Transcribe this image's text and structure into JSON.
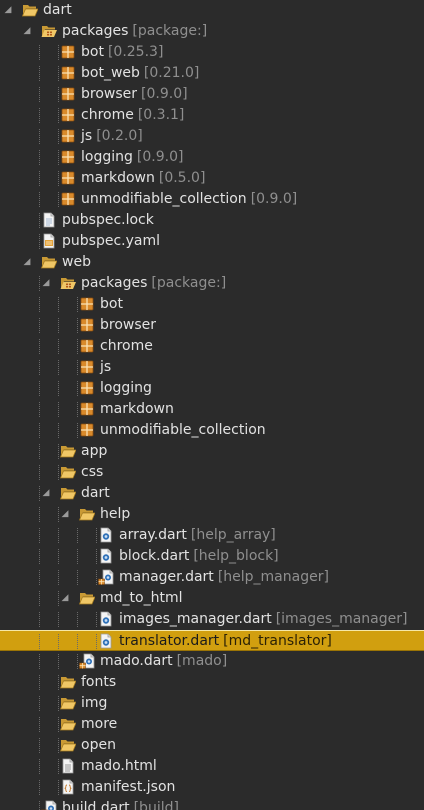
{
  "tree": [
    {
      "label": "dart",
      "decor": "",
      "icon": "folder-open-icon",
      "depth": 0,
      "expanded": true
    },
    {
      "label": "packages",
      "decor": "[package:]",
      "icon": "package-folder-open-icon",
      "depth": 1,
      "expanded": true
    },
    {
      "label": "bot",
      "decor": "[0.25.3]",
      "icon": "package-icon",
      "depth": 2
    },
    {
      "label": "bot_web",
      "decor": "[0.21.0]",
      "icon": "package-icon",
      "depth": 2
    },
    {
      "label": "browser",
      "decor": "[0.9.0]",
      "icon": "package-icon",
      "depth": 2
    },
    {
      "label": "chrome",
      "decor": "[0.3.1]",
      "icon": "package-icon",
      "depth": 2
    },
    {
      "label": "js",
      "decor": "[0.2.0]",
      "icon": "package-icon",
      "depth": 2
    },
    {
      "label": "logging",
      "decor": "[0.9.0]",
      "icon": "package-icon",
      "depth": 2
    },
    {
      "label": "markdown",
      "decor": "[0.5.0]",
      "icon": "package-icon",
      "depth": 2
    },
    {
      "label": "unmodifiable_collection",
      "decor": "[0.9.0]",
      "icon": "package-icon",
      "depth": 2
    },
    {
      "label": "pubspec.lock",
      "decor": "",
      "icon": "file-icon",
      "depth": 1
    },
    {
      "label": "pubspec.yaml",
      "decor": "",
      "icon": "yaml-file-icon",
      "depth": 1
    },
    {
      "label": "web",
      "decor": "",
      "icon": "folder-open-icon",
      "depth": 1,
      "expanded": true
    },
    {
      "label": "packages",
      "decor": "[package:]",
      "icon": "package-folder-open-icon",
      "depth": 2,
      "expanded": true
    },
    {
      "label": "bot",
      "decor": "",
      "icon": "package-icon",
      "depth": 3
    },
    {
      "label": "browser",
      "decor": "",
      "icon": "package-icon",
      "depth": 3
    },
    {
      "label": "chrome",
      "decor": "",
      "icon": "package-icon",
      "depth": 3
    },
    {
      "label": "js",
      "decor": "",
      "icon": "package-icon",
      "depth": 3
    },
    {
      "label": "logging",
      "decor": "",
      "icon": "package-icon",
      "depth": 3
    },
    {
      "label": "markdown",
      "decor": "",
      "icon": "package-icon",
      "depth": 3
    },
    {
      "label": "unmodifiable_collection",
      "decor": "",
      "icon": "package-icon",
      "depth": 3
    },
    {
      "label": "app",
      "decor": "",
      "icon": "folder-open-icon",
      "depth": 2
    },
    {
      "label": "css",
      "decor": "",
      "icon": "folder-open-icon",
      "depth": 2
    },
    {
      "label": "dart",
      "decor": "",
      "icon": "folder-open-icon",
      "depth": 2,
      "expanded": true
    },
    {
      "label": "help",
      "decor": "",
      "icon": "folder-open-icon",
      "depth": 3,
      "expanded": true
    },
    {
      "label": "array.dart",
      "decor": "[help_array]",
      "icon": "dart-file-icon",
      "depth": 4
    },
    {
      "label": "block.dart",
      "decor": "[help_block]",
      "icon": "dart-file-icon",
      "depth": 4
    },
    {
      "label": "manager.dart",
      "decor": "[help_manager]",
      "icon": "dart-library-icon",
      "depth": 4
    },
    {
      "label": "md_to_html",
      "decor": "",
      "icon": "folder-open-icon",
      "depth": 3,
      "expanded": true
    },
    {
      "label": "images_manager.dart",
      "decor": "[images_manager]",
      "icon": "dart-file-icon",
      "depth": 4
    },
    {
      "label": "translator.dart",
      "decor": "[md_translator]",
      "icon": "dart-file-icon",
      "depth": 4,
      "selected": true
    },
    {
      "label": "mado.dart",
      "decor": "[mado]",
      "icon": "dart-library-icon",
      "depth": 3
    },
    {
      "label": "fonts",
      "decor": "",
      "icon": "folder-open-icon",
      "depth": 2
    },
    {
      "label": "img",
      "decor": "",
      "icon": "folder-open-icon",
      "depth": 2
    },
    {
      "label": "more",
      "decor": "",
      "icon": "folder-open-icon",
      "depth": 2
    },
    {
      "label": "open",
      "decor": "",
      "icon": "folder-open-icon",
      "depth": 2
    },
    {
      "label": "mado.html",
      "decor": "",
      "icon": "html-file-icon",
      "depth": 2
    },
    {
      "label": "manifest.json",
      "decor": "",
      "icon": "json-file-icon",
      "depth": 2
    },
    {
      "label": "build.dart",
      "decor": "[build]",
      "icon": "dart-library-icon",
      "depth": 1
    }
  ]
}
